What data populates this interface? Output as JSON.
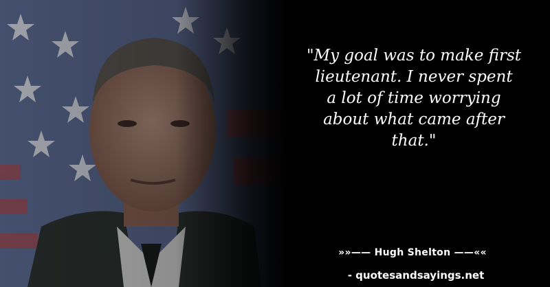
{
  "quote": {
    "lines": [
      "\"My goal was to make first",
      "lieutenant. I never spent",
      "a lot of time worrying",
      "about what came after",
      "that.\""
    ]
  },
  "attribution": "»»—— Hugh Shelton ——««",
  "source": "- quotesandsayings.net",
  "colors": {
    "background": "#000000",
    "text": "#ffffff"
  }
}
